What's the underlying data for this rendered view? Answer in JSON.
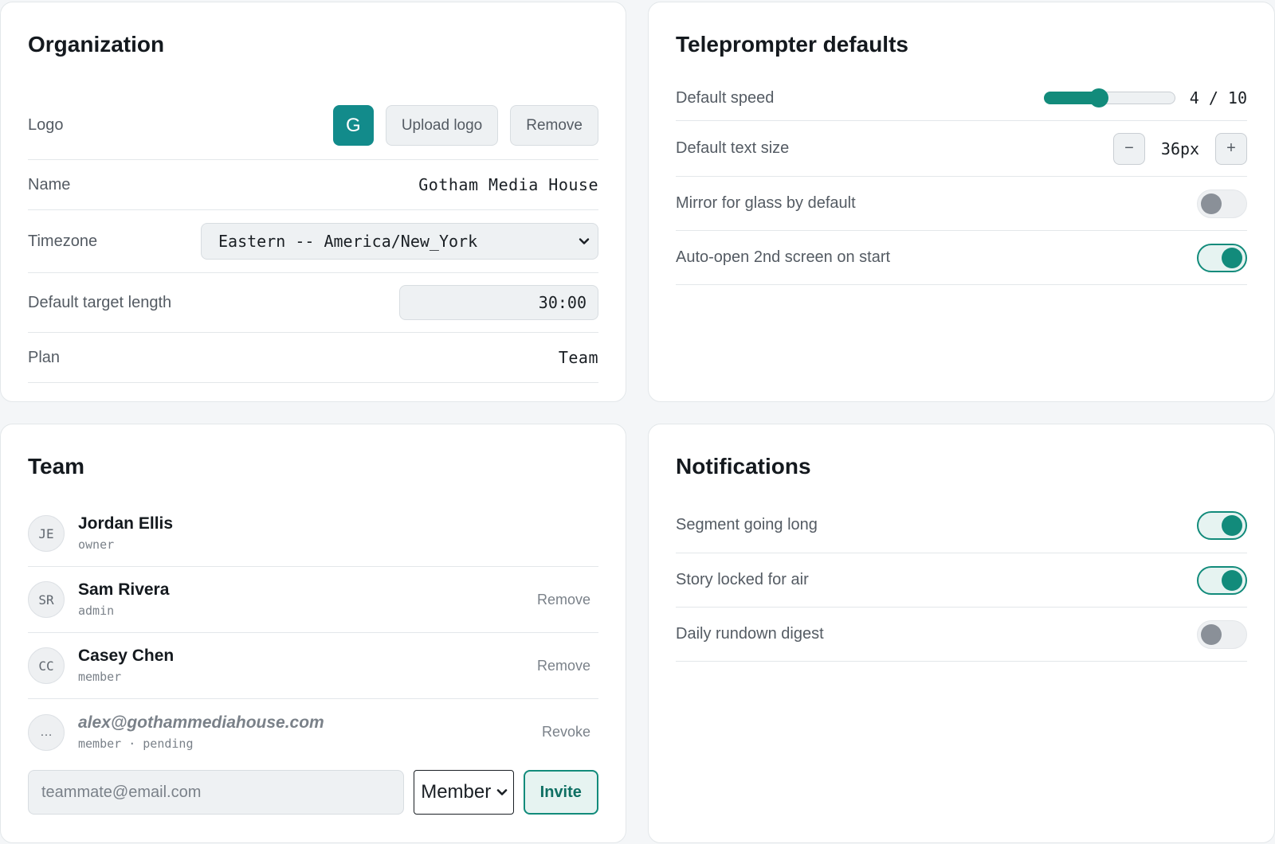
{
  "organization": {
    "title": "Organization",
    "logo": {
      "label": "Logo",
      "initial": "G",
      "upload_label": "Upload logo",
      "remove_label": "Remove"
    },
    "name": {
      "label": "Name",
      "value": "Gotham Media House"
    },
    "timezone": {
      "label": "Timezone",
      "value": "Eastern -- America/New_York"
    },
    "target_length": {
      "label": "Default target length",
      "value": "30:00"
    },
    "plan": {
      "label": "Plan",
      "value": "Team"
    }
  },
  "teleprompter": {
    "title": "Teleprompter defaults",
    "speed": {
      "label": "Default speed",
      "readout": "4 / 10",
      "value": 4,
      "max": 10
    },
    "text_size": {
      "label": "Default text size",
      "minus": "−",
      "value": "36px",
      "plus": "+"
    },
    "mirror": {
      "label": "Mirror for glass by default",
      "on": false
    },
    "auto_open": {
      "label": "Auto-open 2nd screen on start",
      "on": true
    }
  },
  "team": {
    "title": "Team",
    "members": [
      {
        "initials": "JE",
        "name": "Jordan Ellis",
        "role": "owner",
        "action": "",
        "pending": false
      },
      {
        "initials": "SR",
        "name": "Sam Rivera",
        "role": "admin",
        "action": "Remove",
        "pending": false
      },
      {
        "initials": "CC",
        "name": "Casey Chen",
        "role": "member",
        "action": "Remove",
        "pending": false
      },
      {
        "initials": "…",
        "name": "alex@gothammediahouse.com",
        "role": "member · pending",
        "action": "Revoke",
        "pending": true
      }
    ],
    "invite": {
      "placeholder": "teammate@email.com",
      "role_value": "Member",
      "button_label": "Invite"
    }
  },
  "notifications": {
    "title": "Notifications",
    "items": [
      {
        "label": "Segment going long",
        "on": true
      },
      {
        "label": "Story locked for air",
        "on": true
      },
      {
        "label": "Daily rundown digest",
        "on": false
      }
    ]
  }
}
